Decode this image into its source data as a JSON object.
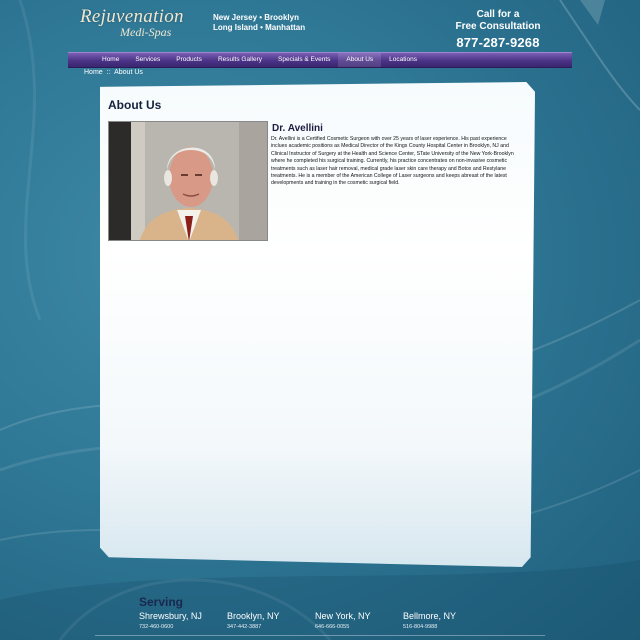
{
  "brand": {
    "logo_main": "Rejuvenation",
    "logo_sub": "Medi-Spas"
  },
  "header": {
    "locations_line1": "New Jersey • Brooklyn",
    "locations_line2": "Long Island • Manhattan",
    "call_line1": "Call for a",
    "call_line2": "Free Consultation",
    "phone": "877-287-9268"
  },
  "nav": {
    "items": [
      {
        "label": "Home"
      },
      {
        "label": "Services"
      },
      {
        "label": "Products"
      },
      {
        "label": "Results Gallery"
      },
      {
        "label": "Specials & Events"
      },
      {
        "label": "About Us"
      },
      {
        "label": "Locations"
      }
    ],
    "active": "About Us"
  },
  "breadcrumb": {
    "home": "Home",
    "separator": "::",
    "current": "About Us"
  },
  "main": {
    "title": "About Us",
    "doctor_name": "Dr. Avellini",
    "bio": "Dr. Avellini is a Certified Cosmetic Surgeon with over 25 years of laser experience. His past experience inclues academic positions as Medical Director of the Kings County Hospital Center in Brooklyn, NJ and Clinical Instructor of Surgery at the Health and Science Center, STate University of the New York-Brooklyn where he completed his surgical training. Currently, his practice concentrates on non-invasive cosmetic treatments such as laser hair removal, medical grade laser skin care therapy and Botox and Restylane treatments. He is a member of the American College of Laser surgeons and keeps abreast of the latest developments and training in the cosmetic surgical field."
  },
  "footer": {
    "serving_label": "Serving",
    "offices": [
      {
        "city": "Shrewsbury, NJ",
        "phone": "732-460-0600"
      },
      {
        "city": "Brooklyn, NY",
        "phone": "347-442-3887"
      },
      {
        "city": "New York, NY",
        "phone": "646-666-0055"
      },
      {
        "city": "Bellmore, NY",
        "phone": "516-804-9988"
      }
    ]
  },
  "colors": {
    "background": "#2f7896",
    "nav": "#4b3386",
    "title": "#14213d"
  },
  "icons": {
    "photo": "doctor-portrait"
  }
}
